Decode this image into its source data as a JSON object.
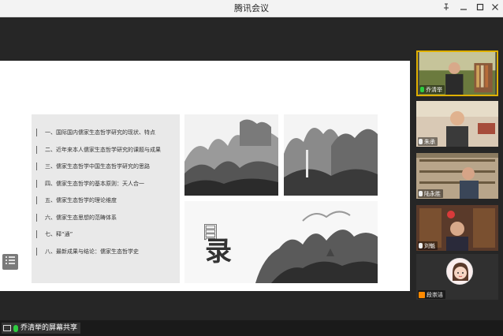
{
  "window": {
    "title": "腾讯会议"
  },
  "toc": {
    "items": [
      "一、国际国内儒家生态哲学研究的现状、特点",
      "二、近年来本人儒家生态哲学研究的课题与成果",
      "三、儒家生态哲学中国生态哲学研究的思路",
      "四、儒家生态哲学的基本原则：天人合一",
      "五、儒家生态哲学的理论维度",
      "六、儒家生态思想的范畴体系",
      "七、释“通”",
      "八、最新成果与结论：儒家生态哲学史"
    ]
  },
  "slide": {
    "mulu_small": "目",
    "mulu_big": "录"
  },
  "share": {
    "label": "乔清举的屏幕共享"
  },
  "participants": [
    {
      "name": "乔清举",
      "active": true,
      "mic": "green"
    },
    {
      "name": "朱承",
      "active": false,
      "mic": "white"
    },
    {
      "name": "陆永胜",
      "active": false,
      "mic": "white"
    },
    {
      "name": "刘魁",
      "active": false,
      "mic": "white"
    },
    {
      "name": "段崇洁",
      "active": false,
      "mic": "none"
    }
  ],
  "icons": {
    "pin": "pin-icon",
    "minimize": "minimize-icon",
    "maximize": "maximize-icon",
    "close": "close-icon",
    "list": "list-icon",
    "screen": "screen-share-icon",
    "mic": "microphone-icon",
    "user": "user-icon"
  },
  "colors": {
    "active_speaker_border": "#e0b000",
    "mic_active": "#2ecc40"
  }
}
